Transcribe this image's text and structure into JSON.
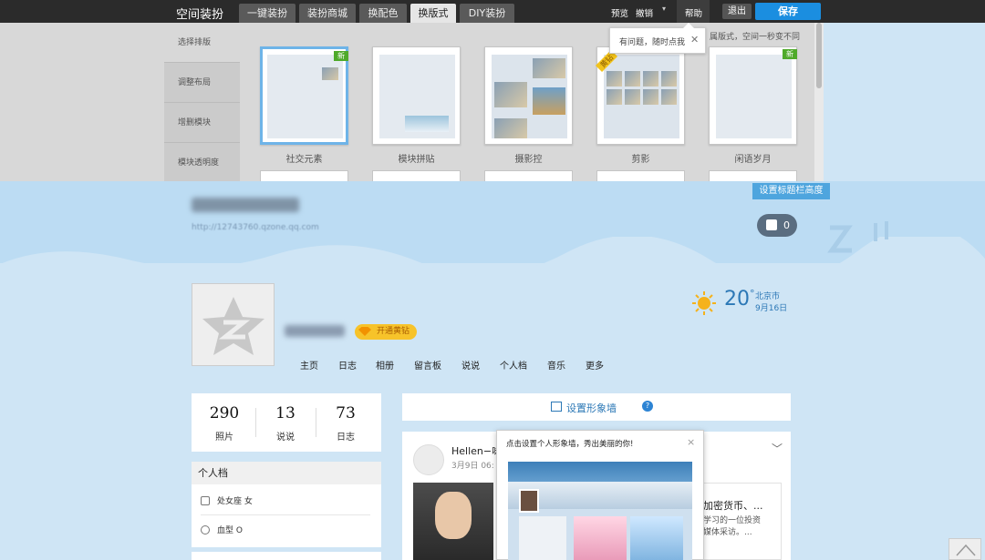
{
  "top": {
    "brand": "空间装扮",
    "tabs": [
      {
        "label": "一键装扮",
        "active": false
      },
      {
        "label": "装扮商城",
        "active": false
      },
      {
        "label": "换配色",
        "active": false
      },
      {
        "label": "换版式",
        "active": true
      },
      {
        "label": "DIY装扮",
        "active": false
      }
    ],
    "preview": "预览",
    "undo": "撤销",
    "help": "帮助",
    "exit": "退出",
    "save": "保存"
  },
  "panel": {
    "left_nav": [
      "选择排版",
      "调整布局",
      "增删模块",
      "模块透明度"
    ],
    "layouts": [
      {
        "label": "社交元素",
        "badge": "新",
        "selected": true
      },
      {
        "label": "模块拼贴",
        "badge": "",
        "selected": false
      },
      {
        "label": "摄影控",
        "badge": "",
        "selected": false
      },
      {
        "label": "剪影",
        "badge": "黄钻",
        "selected": false
      },
      {
        "label": "闲语岁月",
        "badge": "新",
        "selected": false
      }
    ],
    "tooltip": "有问题，随时点我",
    "tip_right": "属版式，空间一秒变不同"
  },
  "banner": {
    "set_title_height": "设置标题栏高度",
    "url": "http://12743760.qzone.qq.com",
    "like_count": "0"
  },
  "profile": {
    "vip_label": "开通黄钻",
    "weather_temp": "20",
    "weather_unit": "°",
    "weather_city": "北京市",
    "weather_date": "9月16日",
    "nav": [
      "主页",
      "日志",
      "相册",
      "留言板",
      "说说",
      "个人档",
      "音乐",
      "更多"
    ]
  },
  "stats": [
    {
      "value": "290",
      "label": "照片"
    },
    {
      "value": "13",
      "label": "说说"
    },
    {
      "value": "73",
      "label": "日志"
    }
  ],
  "info": {
    "title": "个人档",
    "rows": [
      "处女座 女",
      "血型 O"
    ]
  },
  "wall": {
    "label": "设置形象墙",
    "help": "?"
  },
  "feed": {
    "name": "Hellen−咏",
    "date": "3月9日 06:",
    "title": "加密货币、...",
    "excerpt": "学习的一位投资\n媒体采访。..."
  },
  "popup": {
    "title": "点击设置个人形象墙，秀出美丽的你!",
    "close": "×"
  },
  "colors": {
    "topbar": "#2b2b2b",
    "accent": "#1b8ee0",
    "banner": "#bcdcf3",
    "vip": "#f7c32a"
  }
}
